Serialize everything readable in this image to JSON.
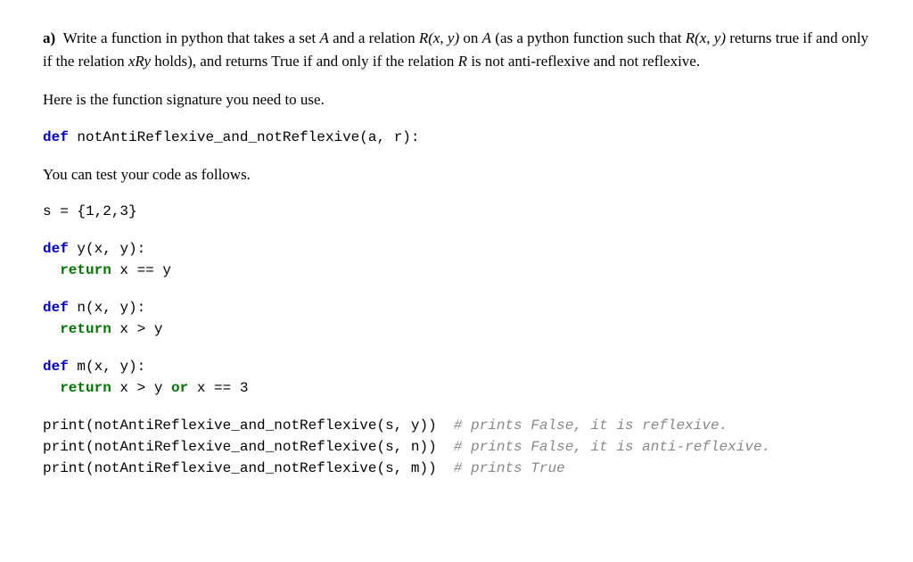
{
  "question": {
    "label": "a)",
    "text_parts": {
      "p1a": "Write a function in python that takes a set ",
      "A": "A",
      "p1b": " and a relation ",
      "Rxy": "R(x, y)",
      "p1c": " on ",
      "p1d": " (as a python function such that ",
      "p1e": " returns true if and only if the relation ",
      "xRy": "xRy",
      "p1f": " holds), and returns True if and only if the relation ",
      "R": "R",
      "p1g": " is not anti-reflexive and not reflexive."
    },
    "sig_intro": "Here is the function signature you need to use.",
    "test_intro": "You can test your code as follows."
  },
  "code": {
    "def": "def",
    "ret": "return",
    "or": "or",
    "sig_fn": "notAntiReflexive_and_notReflexive",
    "sig_params": "(a, r):",
    "s_decl": "s = {1,2,3}",
    "y_fn": "y",
    "y_params": "(x, y):",
    "y_body": " x == y",
    "n_fn": "n",
    "n_params": "(x, y):",
    "n_body": " x > y",
    "m_fn": "m",
    "m_params": "(x, y):",
    "m_body1": " x > y ",
    "m_body2": " x == 3",
    "pr": "print",
    "call1": "(notAntiReflexive_and_notReflexive(s, y))  ",
    "call2": "(notAntiReflexive_and_notReflexive(s, n))  ",
    "call3": "(notAntiReflexive_and_notReflexive(s, m))  ",
    "cmt1": "# prints False, it is reflexive.",
    "cmt2": "# prints False, it is anti-reflexive.",
    "cmt3": "# prints True"
  }
}
